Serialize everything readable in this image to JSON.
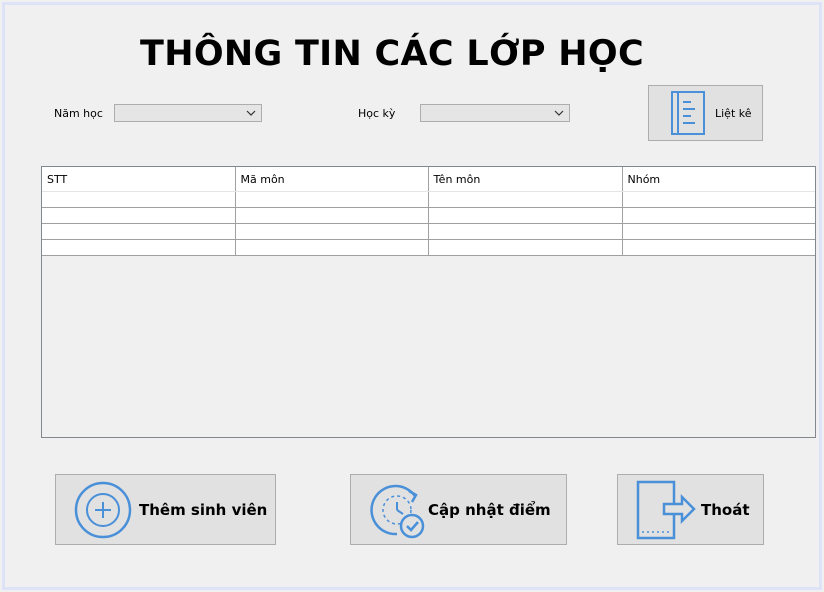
{
  "window": {
    "title": "THÔNG TIN CÁC LỚP HỌC"
  },
  "filters": {
    "year_label": "Năm học",
    "year_value": "",
    "semester_label": "Học kỳ",
    "semester_value": "",
    "list_button_label": "Liệt kê",
    "list_button_icon": "list-icon"
  },
  "table": {
    "columns": [
      "STT",
      "Mã môn",
      "Tên môn",
      "Nhóm"
    ],
    "rows": [
      [
        "",
        "",
        "",
        ""
      ],
      [
        "",
        "",
        "",
        ""
      ],
      [
        "",
        "",
        "",
        ""
      ],
      [
        "",
        "",
        "",
        ""
      ]
    ]
  },
  "actions": {
    "add_student_label": "Thêm sinh viên",
    "add_student_icon": "plus-circle-icon",
    "update_score_label": "Cập nhật điểm",
    "update_score_icon": "refresh-check-icon",
    "exit_label": "Thoát",
    "exit_icon": "exit-icon"
  },
  "colors": {
    "icon_blue": "#4a90d9",
    "button_bg": "#e1e1e1",
    "window_bg": "#f0f0f0"
  }
}
